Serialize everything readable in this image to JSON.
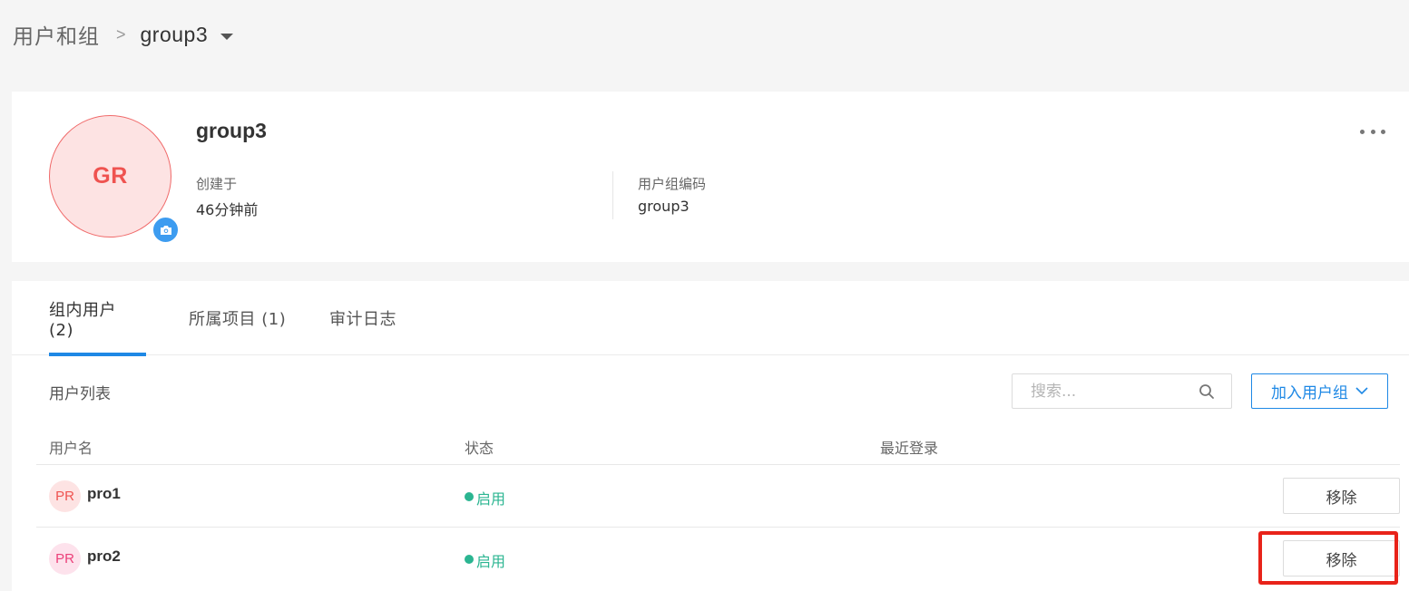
{
  "breadcrumb": {
    "root": "用户和组",
    "separator": ">",
    "current": "group3",
    "dropdown_icon": "caret-down-icon"
  },
  "group": {
    "avatar_initials": "GR",
    "camera_icon": "camera-icon",
    "name": "group3",
    "created_label": "创建于",
    "created_value": "46分钟前",
    "code_label": "用户组编码",
    "code_value": "group3",
    "more_icon": "more-horizontal-icon"
  },
  "tabs": [
    {
      "label": "组内用户 (2)",
      "active": true
    },
    {
      "label": "所属项目 (1)",
      "active": false
    },
    {
      "label": "审计日志",
      "active": false
    }
  ],
  "toolbar": {
    "list_title": "用户列表",
    "search_placeholder": "搜索...",
    "search_value": "",
    "join_label": "加入用户组",
    "join_icon": "chevron-down-icon"
  },
  "table": {
    "columns": [
      "用户名",
      "状态",
      "最近登录"
    ],
    "rows": [
      {
        "avatar": "PR",
        "username": "pro1",
        "status": "启用",
        "last_login": "",
        "action": "移除"
      },
      {
        "avatar": "PR",
        "username": "pro2",
        "status": "启用",
        "last_login": "",
        "action": "移除"
      }
    ]
  },
  "colors": {
    "accent": "#1e88e5",
    "status_enabled": "#2bb591",
    "avatar_red": "#ef5350",
    "avatar_pink": "#ec407a",
    "highlight": "#e8231a"
  }
}
